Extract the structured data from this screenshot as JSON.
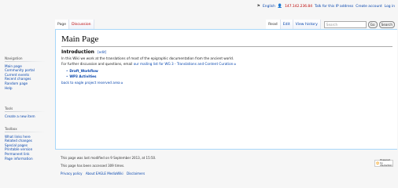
{
  "personal": {
    "language": "English",
    "ip": "147.142.236.84",
    "talk": "Talk for this IP address",
    "create": "Create account",
    "login": "Log in"
  },
  "tabs": {
    "page": "Page",
    "discussion": "Discussion",
    "read": "Read",
    "edit": "Edit",
    "history": "View history"
  },
  "search": {
    "placeholder": "Search",
    "go": "Go",
    "search": "Search"
  },
  "sidebar": {
    "navigation": {
      "heading": "Navigation",
      "items": [
        "Main page",
        "Community portal",
        "Current events",
        "Recent changes",
        "Random page",
        "Help"
      ]
    },
    "tools": {
      "heading": "Tools",
      "items": [
        "Create a new item"
      ]
    },
    "toolbox": {
      "heading": "Toolbox",
      "items": [
        "What links here",
        "Related changes",
        "Special pages",
        "Printable version",
        "Permanent link",
        "Page information"
      ]
    }
  },
  "content": {
    "title": "Main Page",
    "section": "Introduction",
    "edit": "[edit]",
    "p1": "In this Wiki we work at the translations of most of the epigraphic documentation from the ancient world.",
    "p2_prefix": "For further discussion and questions, email ",
    "p2_link": "our mailing list for WG 3 - Translations and Content Curation",
    "list": [
      "Draft_Workflow",
      "WP3 Activities"
    ],
    "back": "back to eagle project reserved area"
  },
  "footer": {
    "modified": "This page was last modified on 9 September 2013, at 15:50.",
    "accessed": "This page has been accessed 309 times.",
    "links": [
      "Privacy policy",
      "About EAGLE MediaWiki",
      "Disclaimers"
    ],
    "powered_line1": "Powered by",
    "powered_line2": "MediaWiki"
  }
}
